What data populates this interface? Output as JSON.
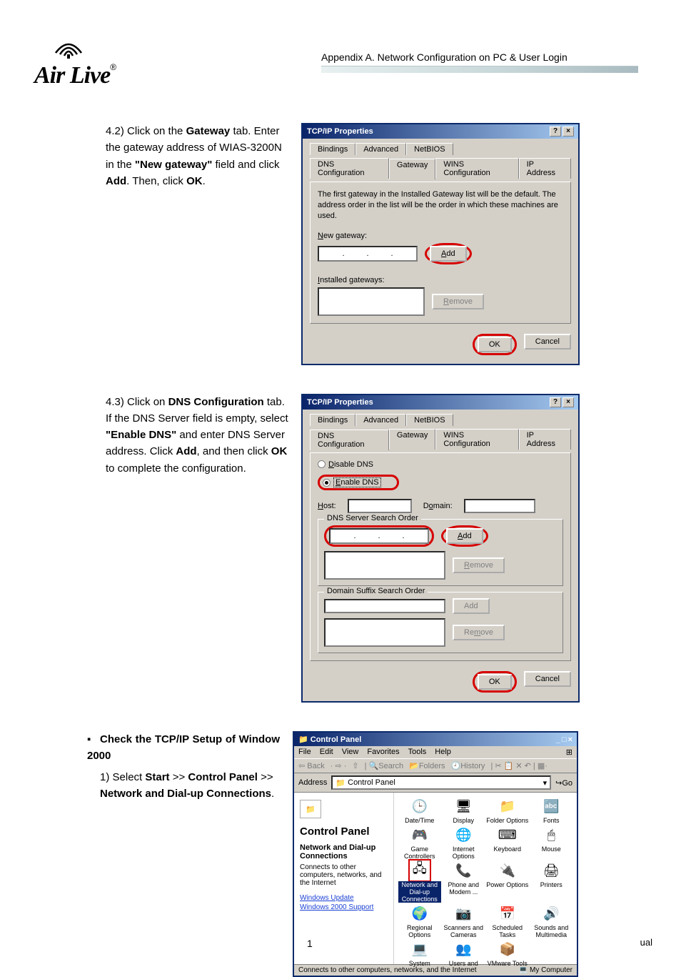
{
  "header": {
    "appendix": "Appendix A. Network Configuration on PC & User Login",
    "logo_text": "Air Live",
    "logo_reg": "®"
  },
  "step42": {
    "num": "4.2)",
    "t1": "Click on the ",
    "gateway": "Gateway",
    "t2": " tab. Enter the gateway address of WIAS-3200N in the ",
    "newgw": "\"New gateway\"",
    "t3": " field and click ",
    "add": "Add",
    "t4": ". Then, click ",
    "ok": "OK",
    "t5": "."
  },
  "dlg1": {
    "title": "TCP/IP Properties",
    "tabs_top": [
      "Bindings",
      "Advanced",
      "NetBIOS"
    ],
    "tabs_bot": [
      "DNS Configuration",
      "Gateway",
      "WINS Configuration",
      "IP Address"
    ],
    "help": "The first gateway in the Installed Gateway list will be the default. The address order in the list will be the order in which these machines are used.",
    "newgw_u": "N",
    "newgw_rest": "ew gateway:",
    "add_u": "A",
    "add_rest": "dd",
    "instgw_u": "I",
    "instgw_rest": "nstalled gateways:",
    "remove_u": "R",
    "remove_rest": "emove",
    "ok": "OK",
    "cancel": "Cancel"
  },
  "step43": {
    "num": "4.3)",
    "t1": "Click on ",
    "dnsconf": "DNS Configuration",
    "t2": " tab. If the DNS Server field is empty, select ",
    "enable": "\"Enable DNS\"",
    "t3": " and enter DNS Server address. Click ",
    "add": "Add",
    "t4": ", and then click ",
    "ok": "OK",
    "t5": " to complete the configuration."
  },
  "dlg2": {
    "title": "TCP/IP Properties",
    "disable_u": "D",
    "disable_rest": "isable DNS",
    "enable_u": "E",
    "enable_rest": "nable DNS",
    "host_u": "H",
    "host_rest": "ost:",
    "domain_u": "o",
    "domain_pre": "D",
    "domain_rest": "main:",
    "search_label": "DNS Server Search Order",
    "add_u": "A",
    "add_rest": "dd",
    "remove_u": "R",
    "remove_rest": "emove",
    "suffix_label": "Domain Suffix Search Order",
    "add2": "Add",
    "remove2_u": "m",
    "remove2_pre": "Re",
    "remove2_rest": "ove",
    "ok": "OK",
    "cancel": "Cancel"
  },
  "step_w2k": {
    "bullet_title": "Check the TCP/IP Setup of Window 2000",
    "num": "1)",
    "t1": "Select ",
    "start": "Start",
    "sep": " >> ",
    "cp": "Control Panel",
    "ndc": "Network and Dial-up Connections",
    "t2": "."
  },
  "cp": {
    "title": "Control Panel",
    "menus": [
      "File",
      "Edit",
      "View",
      "Favorites",
      "Tools",
      "Help"
    ],
    "toolbar": {
      "back": "Back",
      "search": "Search",
      "folders": "Folders",
      "history": "History"
    },
    "addr_label": "Address",
    "addr_value": "Control Panel",
    "go": "Go",
    "side_heading": "Control Panel",
    "side_sub": "Network and Dial-up Connections",
    "side_desc": "Connects to other computers, networks, and the Internet",
    "links": [
      "Windows Update",
      "Windows 2000 Support"
    ],
    "icons": [
      {
        "n": "Date/Time",
        "g": "🕒"
      },
      {
        "n": "Display",
        "g": "🖥"
      },
      {
        "n": "Folder Options",
        "g": "📁"
      },
      {
        "n": "Fonts",
        "g": "🔤"
      },
      {
        "n": "Game Controllers",
        "g": "🎮"
      },
      {
        "n": "Internet Options",
        "g": "🌐"
      },
      {
        "n": "Keyboard",
        "g": "⌨"
      },
      {
        "n": "Mouse",
        "g": "🖱"
      },
      {
        "n": "Network and Dial-up Connections",
        "g": "🖧",
        "sel": true
      },
      {
        "n": "Phone and Modem ...",
        "g": "📞"
      },
      {
        "n": "Power Options",
        "g": "🔌"
      },
      {
        "n": "Printers",
        "g": "🖨"
      },
      {
        "n": "Regional Options",
        "g": "🌍"
      },
      {
        "n": "Scanners and Cameras",
        "g": "📷"
      },
      {
        "n": "Scheduled Tasks",
        "g": "📅"
      },
      {
        "n": "Sounds and Multimedia",
        "g": "🔊"
      },
      {
        "n": "System",
        "g": "💻"
      },
      {
        "n": "Users and",
        "g": "👥"
      },
      {
        "n": "VMware Tools",
        "g": "📦"
      }
    ],
    "status_left": "Connects to other computers, networks, and the Internet",
    "status_right": "My Computer"
  },
  "footer": {
    "page": "1",
    "right": "ual"
  }
}
